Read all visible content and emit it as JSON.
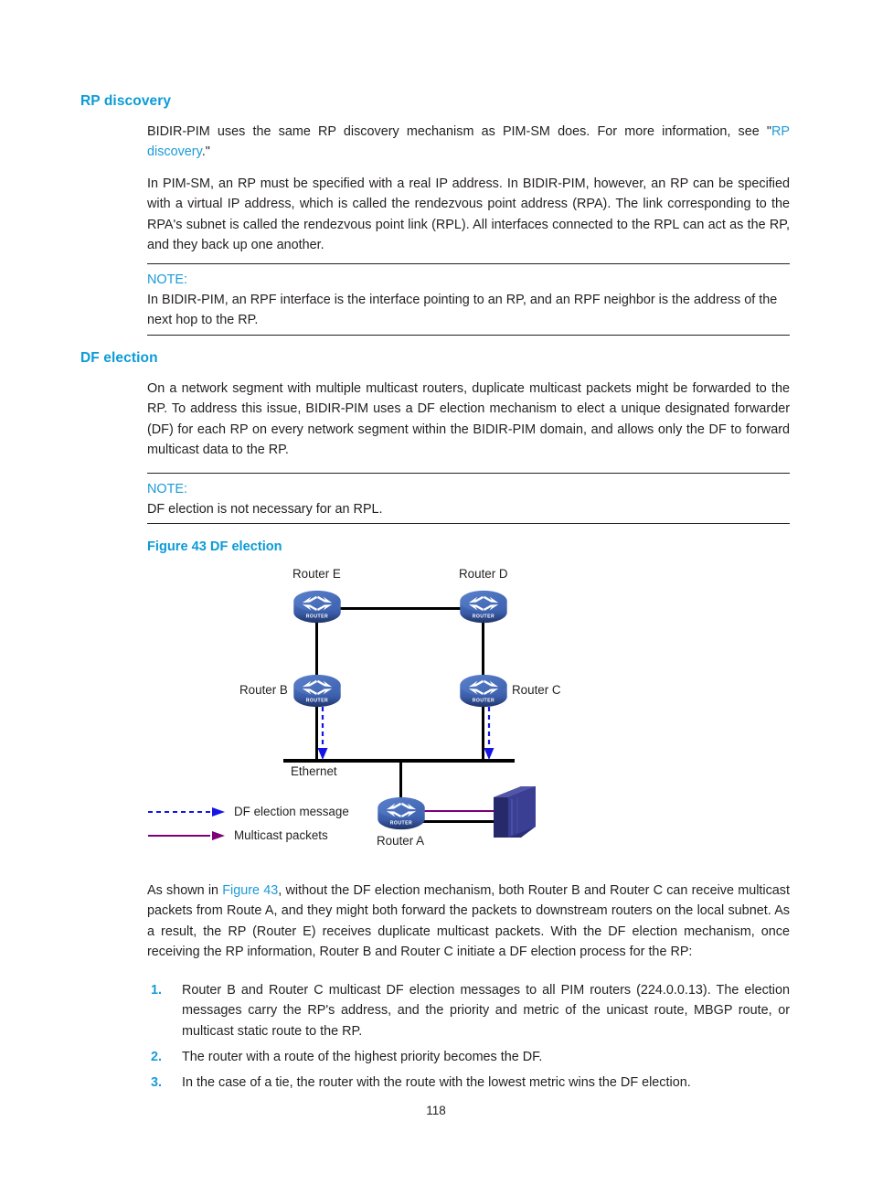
{
  "page": {
    "number": "118"
  },
  "sections": [
    {
      "heading": "RP discovery",
      "paragraphs": [
        {
          "before": "BIDIR-PIM uses the same RP discovery mechanism as PIM-SM does. For more information, see \"",
          "link": "RP discovery",
          "after": ".\""
        },
        {
          "text": "In PIM-SM, an RP must be specified with a real IP address. In BIDIR-PIM, however, an RP can be specified with a virtual IP address, which is called the rendezvous point address (RPA). The link corresponding to the RPA's subnet is called the rendezvous point link (RPL). All interfaces connected to the RPL can act as the RP, and they back up one another."
        }
      ],
      "note": {
        "title": "NOTE:",
        "body": "In BIDIR-PIM, an RPF interface is the interface pointing to an RP, and an RPF neighbor is the address of the next hop to the RP."
      }
    },
    {
      "heading": "DF election",
      "paragraphs": [
        {
          "text": "On a network segment with multiple multicast routers, duplicate multicast packets might be forwarded to the RP. To address this issue, BIDIR-PIM uses a DF election mechanism to elect a unique designated forwarder (DF) for each RP on every network segment within the BIDIR-PIM domain, and allows only the DF to forward multicast data to the RP."
        }
      ],
      "note": {
        "title": "NOTE:",
        "body": "DF election is not necessary for an RPL."
      }
    }
  ],
  "figure": {
    "caption": "Figure 43 DF election",
    "nodes": [
      {
        "id": "router-e",
        "label": "Router E"
      },
      {
        "id": "router-d",
        "label": "Router D"
      },
      {
        "id": "router-b",
        "label": "Router B"
      },
      {
        "id": "router-c",
        "label": "Router C"
      },
      {
        "id": "router-a",
        "label": "Router A"
      }
    ],
    "bus_label": "Ethernet",
    "legend": [
      {
        "id": "df-election-message",
        "label": "DF election  message",
        "color": "#1414e6",
        "style": "dashed"
      },
      {
        "id": "multicast-packets",
        "label": "Multicast packets",
        "color": "#7b007b",
        "style": "solid"
      }
    ],
    "colors": {
      "router_body": "#3a5ca8",
      "router_top": "#4a6fbf",
      "server": "#3b3f8f",
      "wire": "#000000",
      "election_arrow": "#1414e6",
      "multicast_arrow": "#7b007b"
    }
  },
  "closing": {
    "before": "As shown in ",
    "link": "Figure 43",
    "after": ", without the DF election mechanism, both Router B and Router C can receive multicast packets from Route A, and they might both forward the packets to downstream routers on the local subnet. As a result, the RP (Router E) receives duplicate multicast packets. With the DF election mechanism, once receiving the RP information, Router B and Router C initiate a DF election process for the RP:"
  },
  "steps": [
    {
      "num": "1.",
      "text": "Router B and Router C multicast DF election messages to all PIM routers (224.0.0.13). The election messages carry the RP's address, and the priority and metric of the unicast route, MBGP route, or multicast static route to the RP."
    },
    {
      "num": "2.",
      "text": "The router with a route of the highest priority becomes the DF."
    },
    {
      "num": "3.",
      "text": "In the case of a tie, the router with the route with the lowest metric wins the DF election."
    }
  ]
}
